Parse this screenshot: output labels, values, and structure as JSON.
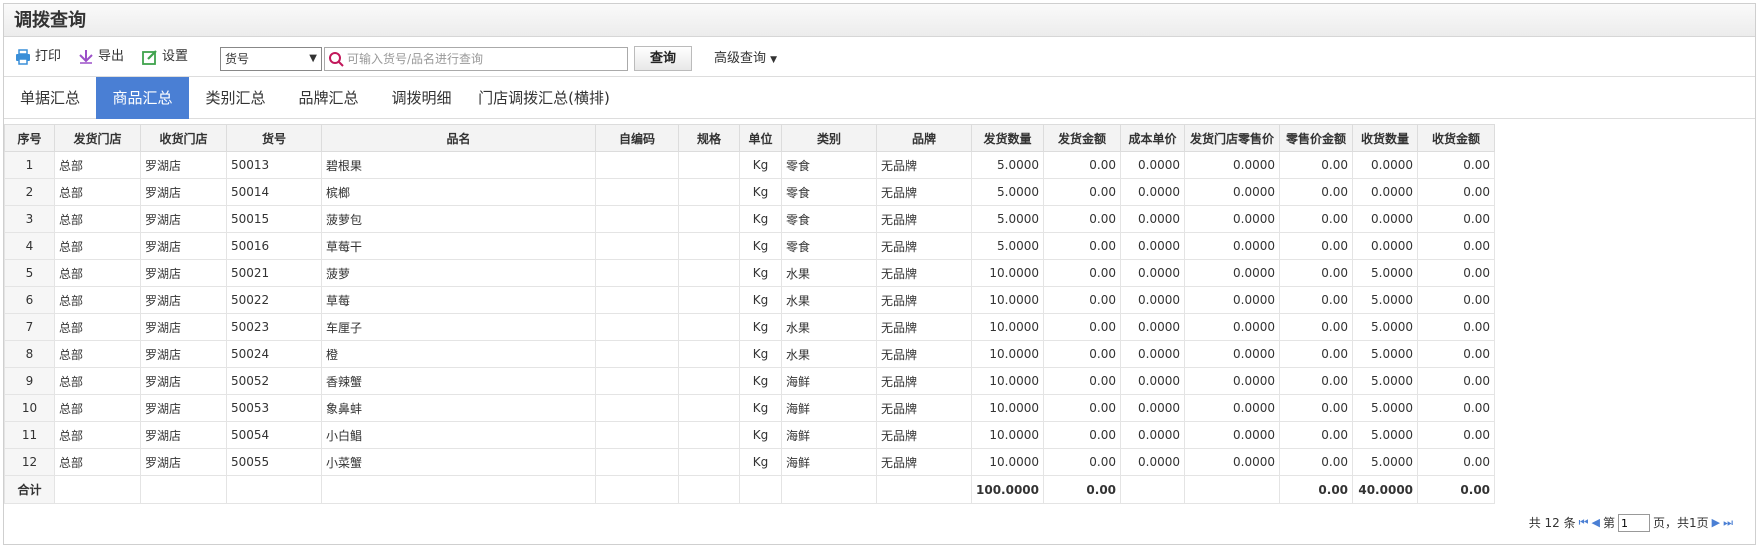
{
  "page": {
    "title": "调拨查询"
  },
  "toolbar": {
    "print_label": "打印",
    "export_label": "导出",
    "settings_label": "设置",
    "field_select_value": "货号",
    "search_placeholder": "可输入货号/品名进行查询",
    "query_label": "查询",
    "advanced_label": "高级查询"
  },
  "tabs": [
    {
      "label": "单据汇总",
      "active": false
    },
    {
      "label": "商品汇总",
      "active": true
    },
    {
      "label": "类别汇总",
      "active": false
    },
    {
      "label": "品牌汇总",
      "active": false
    },
    {
      "label": "调拨明细",
      "active": false
    },
    {
      "label": "门店调拨汇总(横排)",
      "active": false
    }
  ],
  "table": {
    "headers": [
      "序号",
      "发货门店",
      "收货门店",
      "货号",
      "品名",
      "自编码",
      "规格",
      "单位",
      "类别",
      "品牌",
      "发货数量",
      "发货金额",
      "成本单价",
      "发货门店零售价",
      "零售价金额",
      "收货数量",
      "收货金额"
    ],
    "rows": [
      [
        "1",
        "总部",
        "罗湖店",
        "50013",
        "碧根果",
        "",
        "",
        "Kg",
        "零食",
        "无品牌",
        "5.0000",
        "0.00",
        "0.0000",
        "0.0000",
        "0.00",
        "0.0000",
        "0.00"
      ],
      [
        "2",
        "总部",
        "罗湖店",
        "50014",
        "槟榔",
        "",
        "",
        "Kg",
        "零食",
        "无品牌",
        "5.0000",
        "0.00",
        "0.0000",
        "0.0000",
        "0.00",
        "0.0000",
        "0.00"
      ],
      [
        "3",
        "总部",
        "罗湖店",
        "50015",
        "菠萝包",
        "",
        "",
        "Kg",
        "零食",
        "无品牌",
        "5.0000",
        "0.00",
        "0.0000",
        "0.0000",
        "0.00",
        "0.0000",
        "0.00"
      ],
      [
        "4",
        "总部",
        "罗湖店",
        "50016",
        "草莓干",
        "",
        "",
        "Kg",
        "零食",
        "无品牌",
        "5.0000",
        "0.00",
        "0.0000",
        "0.0000",
        "0.00",
        "0.0000",
        "0.00"
      ],
      [
        "5",
        "总部",
        "罗湖店",
        "50021",
        "菠萝",
        "",
        "",
        "Kg",
        "水果",
        "无品牌",
        "10.0000",
        "0.00",
        "0.0000",
        "0.0000",
        "0.00",
        "5.0000",
        "0.00"
      ],
      [
        "6",
        "总部",
        "罗湖店",
        "50022",
        "草莓",
        "",
        "",
        "Kg",
        "水果",
        "无品牌",
        "10.0000",
        "0.00",
        "0.0000",
        "0.0000",
        "0.00",
        "5.0000",
        "0.00"
      ],
      [
        "7",
        "总部",
        "罗湖店",
        "50023",
        "车厘子",
        "",
        "",
        "Kg",
        "水果",
        "无品牌",
        "10.0000",
        "0.00",
        "0.0000",
        "0.0000",
        "0.00",
        "5.0000",
        "0.00"
      ],
      [
        "8",
        "总部",
        "罗湖店",
        "50024",
        "橙",
        "",
        "",
        "Kg",
        "水果",
        "无品牌",
        "10.0000",
        "0.00",
        "0.0000",
        "0.0000",
        "0.00",
        "5.0000",
        "0.00"
      ],
      [
        "9",
        "总部",
        "罗湖店",
        "50052",
        "香辣蟹",
        "",
        "",
        "Kg",
        "海鲜",
        "无品牌",
        "10.0000",
        "0.00",
        "0.0000",
        "0.0000",
        "0.00",
        "5.0000",
        "0.00"
      ],
      [
        "10",
        "总部",
        "罗湖店",
        "50053",
        "象鼻蚌",
        "",
        "",
        "Kg",
        "海鲜",
        "无品牌",
        "10.0000",
        "0.00",
        "0.0000",
        "0.0000",
        "0.00",
        "5.0000",
        "0.00"
      ],
      [
        "11",
        "总部",
        "罗湖店",
        "50054",
        "小白鲳",
        "",
        "",
        "Kg",
        "海鲜",
        "无品牌",
        "10.0000",
        "0.00",
        "0.0000",
        "0.0000",
        "0.00",
        "5.0000",
        "0.00"
      ],
      [
        "12",
        "总部",
        "罗湖店",
        "50055",
        "小菜蟹",
        "",
        "",
        "Kg",
        "海鲜",
        "无品牌",
        "10.0000",
        "0.00",
        "0.0000",
        "0.0000",
        "0.00",
        "5.0000",
        "0.00"
      ]
    ],
    "total": [
      "合计",
      "",
      "",
      "",
      "",
      "",
      "",
      "",
      "",
      "",
      "100.0000",
      "0.00",
      "",
      "",
      "0.00",
      "40.0000",
      "0.00"
    ]
  },
  "pager": {
    "total_text": "共 12 条",
    "page_prefix": "第",
    "current_page": "1",
    "page_suffix": "页，共1页"
  },
  "colors": {
    "accent": "#4a7fd4",
    "header_bg": "#f3f3f3"
  },
  "icons": {
    "print": "printer-icon",
    "export": "export-icon",
    "settings": "edit-icon",
    "search": "search-icon"
  }
}
